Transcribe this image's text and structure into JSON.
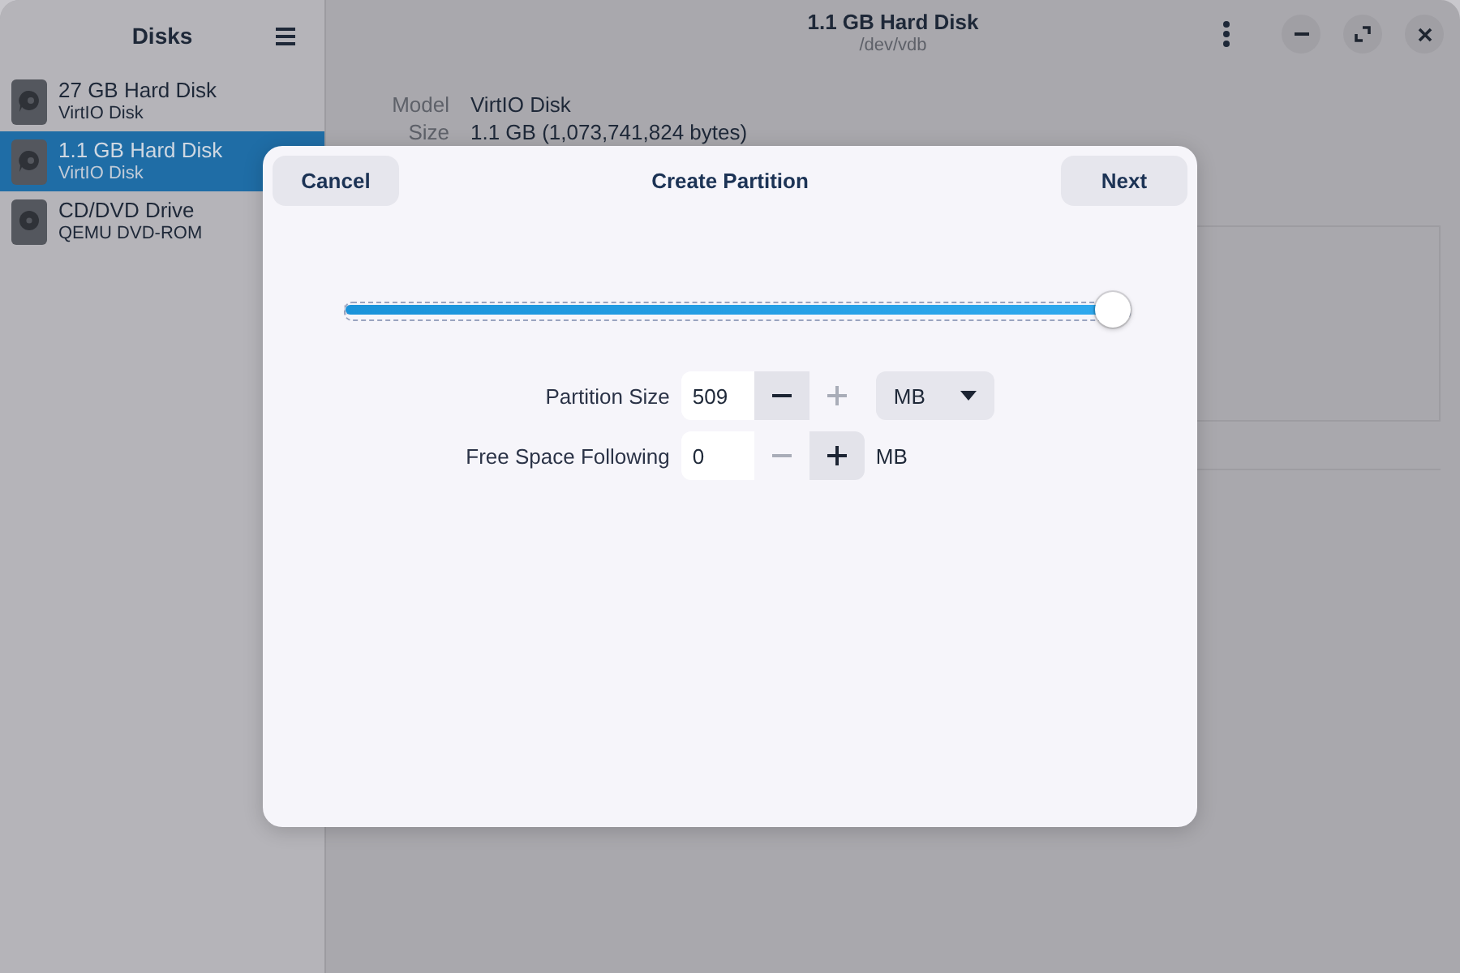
{
  "sidebar": {
    "title": "Disks",
    "items": [
      {
        "kind": "hard-disk",
        "title": "27 GB Hard Disk",
        "subtitle": "VirtIO Disk",
        "selected": false
      },
      {
        "kind": "hard-disk",
        "title": "1.1 GB Hard Disk",
        "subtitle": "VirtIO Disk",
        "selected": true
      },
      {
        "kind": "optical",
        "title": "CD/DVD Drive",
        "subtitle": "QEMU DVD-ROM",
        "selected": false
      }
    ]
  },
  "header": {
    "title": "1.1 GB Hard Disk",
    "subtitle": "/dev/vdb"
  },
  "properties": [
    {
      "label": "Model",
      "value": "VirtIO Disk"
    },
    {
      "label": "Size",
      "value": "1.1 GB (1,073,741,824 bytes)"
    }
  ],
  "dialog": {
    "title": "Create Partition",
    "cancel": "Cancel",
    "next": "Next",
    "slider": {
      "level": 1.0
    },
    "rows": [
      {
        "label": "Partition Size",
        "value": "509",
        "decrease_disabled": false,
        "increase_disabled": true,
        "unit": {
          "kind": "dropdown",
          "text": "MB"
        }
      },
      {
        "label": "Free Space Following",
        "value": "0",
        "decrease_disabled": true,
        "increase_disabled": false,
        "unit": {
          "kind": "label",
          "text": "MB"
        }
      }
    ]
  }
}
